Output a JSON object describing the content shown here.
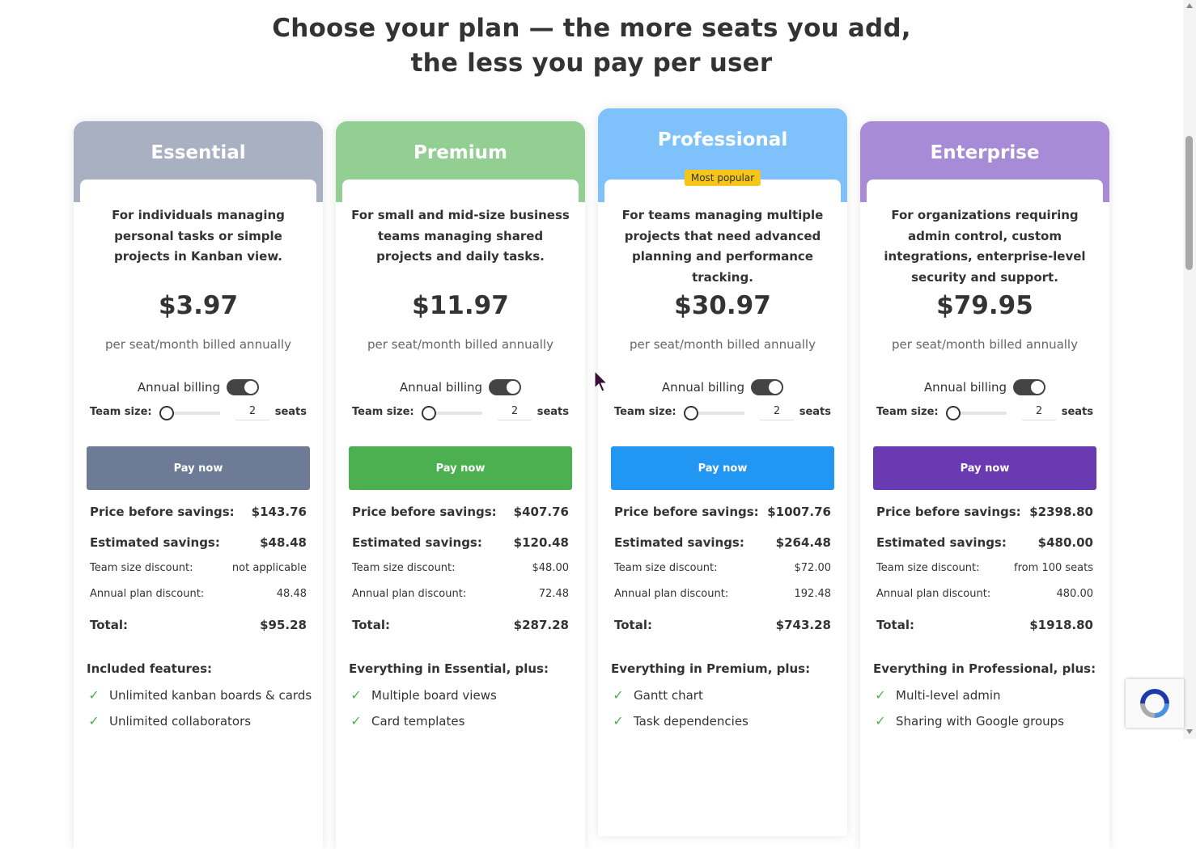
{
  "headline": {
    "line1": "Choose your plan — the more seats you add,",
    "line2": "the less you pay per user"
  },
  "plans": [
    {
      "name": "Essential",
      "color": "#a8b0c2",
      "button_color": "#6e7b96",
      "badge": "",
      "description": "For individuals managing personal tasks or simple projects in Kanban view.",
      "price": "$3.97",
      "per": "per seat/month billed annually",
      "billing_label": "Annual billing",
      "team_label": "Team size:",
      "team_value": "2",
      "seats_label": "seats",
      "pay_label": "Pay now",
      "price_before_label": "Price before savings:",
      "price_before": "$143.76",
      "savings_label": "Estimated savings:",
      "savings": "$48.48",
      "team_discount_label": "Team size discount:",
      "team_discount": "not applicable",
      "annual_discount_label": "Annual plan discount:",
      "annual_discount": "48.48",
      "total_label": "Total:",
      "total": "$95.28",
      "features_title": "Included features:",
      "features": [
        "Unlimited kanban boards & cards",
        "Unlimited collaborators"
      ]
    },
    {
      "name": "Premium",
      "color": "#93cf93",
      "button_color": "#4caf50",
      "badge": "",
      "description": "For small and mid-size business teams managing shared projects and daily tasks.",
      "price": "$11.97",
      "per": "per seat/month billed annually",
      "billing_label": "Annual billing",
      "team_label": "Team size:",
      "team_value": "2",
      "seats_label": "seats",
      "pay_label": "Pay now",
      "price_before_label": "Price before savings:",
      "price_before": "$407.76",
      "savings_label": "Estimated savings:",
      "savings": "$120.48",
      "team_discount_label": "Team size discount:",
      "team_discount": "$48.00",
      "annual_discount_label": "Annual plan discount:",
      "annual_discount": "72.48",
      "total_label": "Total:",
      "total": "$287.28",
      "features_title": "Everything in Essential, plus:",
      "features": [
        "Multiple board views",
        "Card templates"
      ]
    },
    {
      "name": "Professional",
      "color": "#7fc2fb",
      "button_color": "#2196f3",
      "badge": "Most popular",
      "description": "For teams managing multiple projects that need advanced planning and performance tracking.",
      "price": "$30.97",
      "per": "per seat/month billed annually",
      "billing_label": "Annual billing",
      "team_label": "Team size:",
      "team_value": "2",
      "seats_label": "seats",
      "pay_label": "Pay now",
      "price_before_label": "Price before savings:",
      "price_before": "$1007.76",
      "savings_label": "Estimated savings:",
      "savings": "$264.48",
      "team_discount_label": "Team size discount:",
      "team_discount": "$72.00",
      "annual_discount_label": "Annual plan discount:",
      "annual_discount": "192.48",
      "total_label": "Total:",
      "total": "$743.28",
      "features_title": "Everything in Premium, plus:",
      "features": [
        "Gantt chart",
        "Task dependencies"
      ]
    },
    {
      "name": "Enterprise",
      "color": "#a78bd6",
      "button_color": "#6a3ab2",
      "badge": "",
      "description": "For organizations requiring admin control, custom integrations, enterprise-level security and support.",
      "price": "$79.95",
      "per": "per seat/month billed annually",
      "billing_label": "Annual billing",
      "team_label": "Team size:",
      "team_value": "2",
      "seats_label": "seats",
      "pay_label": "Pay now",
      "price_before_label": "Price before savings:",
      "price_before": "$2398.80",
      "savings_label": "Estimated savings:",
      "savings": "$480.00",
      "team_discount_label": "Team size discount:",
      "team_discount": "from 100 seats",
      "annual_discount_label": "Annual plan discount:",
      "annual_discount": "480.00",
      "total_label": "Total:",
      "total": "$1918.80",
      "features_title": "Everything in Professional, plus:",
      "features": [
        "Multi-level admin",
        "Sharing with Google groups"
      ]
    }
  ],
  "icons": {
    "check": "check-icon",
    "cursor": "mouse-pointer-icon",
    "recaptcha": "recaptcha-icon"
  }
}
